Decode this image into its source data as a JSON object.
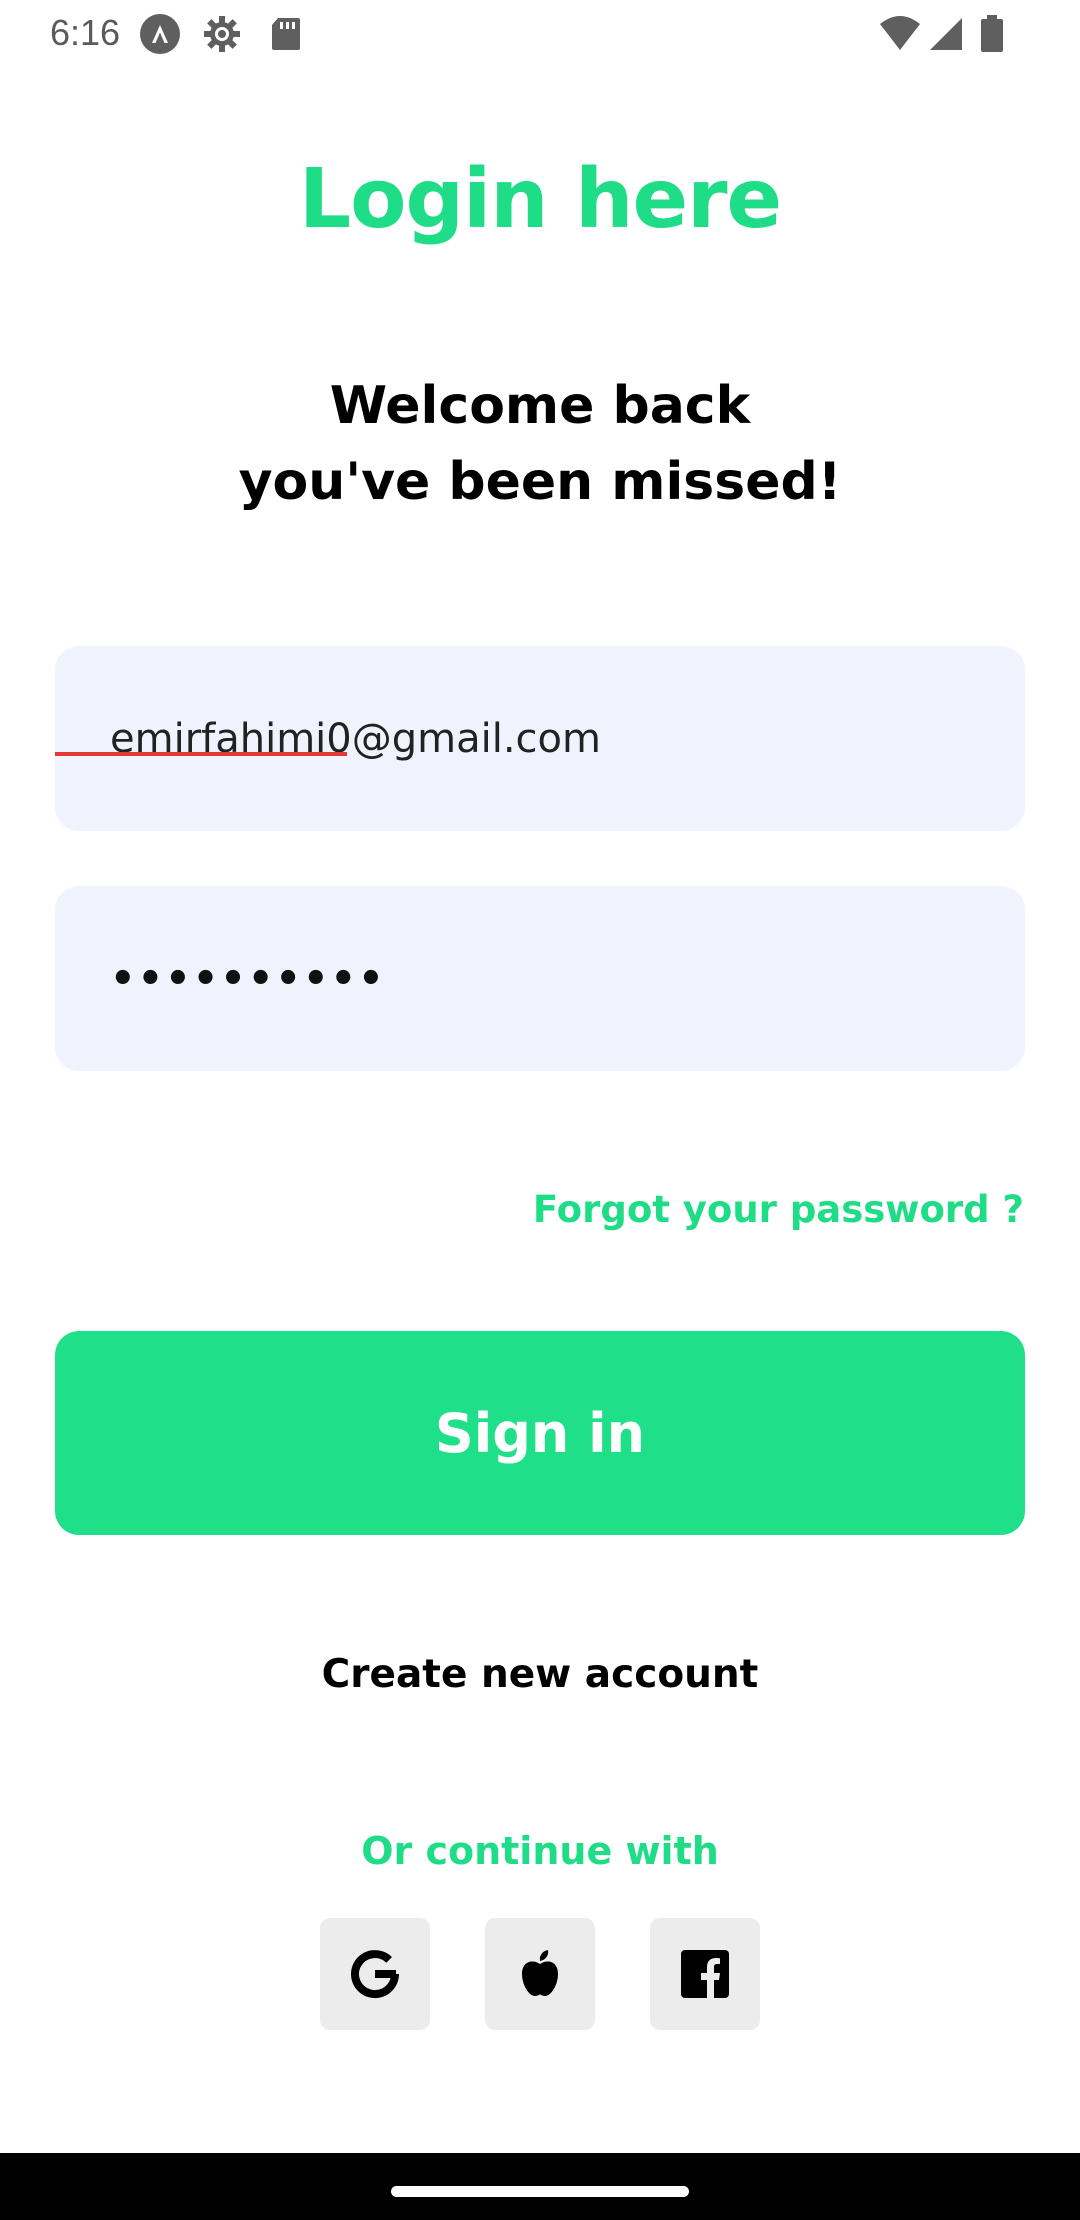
{
  "status_bar": {
    "time": "6:16",
    "left_icons": [
      "app-a-icon",
      "settings-gear-icon",
      "sd-card-icon"
    ],
    "right_icons": [
      "wifi-icon",
      "cell-signal-icon",
      "battery-icon"
    ]
  },
  "header": {
    "title": "Login here",
    "subtitle_line1": "Welcome back",
    "subtitle_line2": "you've been missed!"
  },
  "form": {
    "email_value": "emirfahimi0@gmail.com",
    "password_value": "••••••••••",
    "forgot_label": "Forgot your password ?",
    "signin_label": "Sign in",
    "create_account_label": "Create new account"
  },
  "social": {
    "heading": "Or continue with",
    "providers": [
      "google-icon",
      "apple-icon",
      "facebook-icon"
    ]
  },
  "colors": {
    "accent": "#1fdc86",
    "field_bg": "#f0f3fe",
    "social_bg": "#ececec"
  }
}
